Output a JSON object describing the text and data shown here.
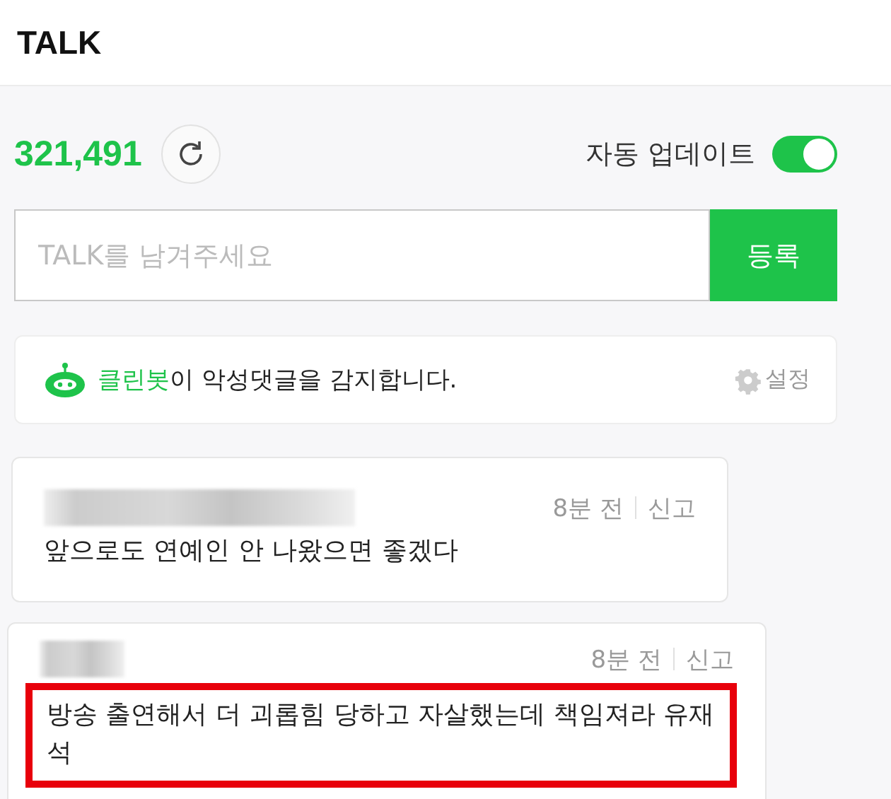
{
  "header": {
    "title": "TALK"
  },
  "counter": {
    "count": "321,491",
    "auto_update_label": "자동 업데이트",
    "auto_update_on": true
  },
  "compose": {
    "placeholder": "TALK를 남겨주세요",
    "submit": "등록"
  },
  "cleanbot": {
    "name": "클린봇",
    "message": "이 악성댓글을 감지합니다.",
    "settings": "설정"
  },
  "comments": [
    {
      "time": "8분 전",
      "report": "신고",
      "text": "앞으로도 연예인 안 나왔으면 좋겠다",
      "highlighted": false
    },
    {
      "time": "8분 전",
      "report": "신고",
      "text": "방송 출연해서 더 괴롭힘 당하고 자살했는데 책임져라 유재석",
      "highlighted": true
    }
  ]
}
